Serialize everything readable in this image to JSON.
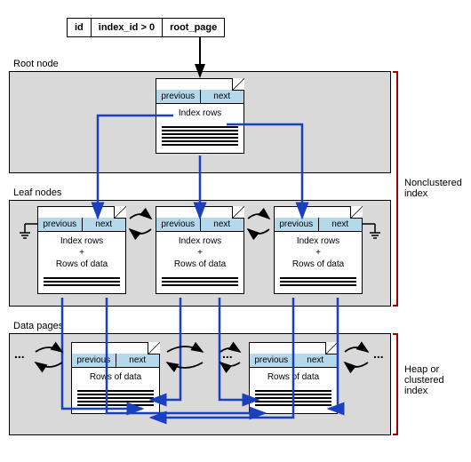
{
  "header": {
    "col1": "id",
    "col2": "index_id > 0",
    "col3": "root_page"
  },
  "bands": {
    "root": "Root node",
    "leaf": "Leaf nodes",
    "data": "Data pages"
  },
  "page": {
    "prev": "previous",
    "next": "next",
    "index_rows": "Index rows",
    "index_rows_plus": "Index rows",
    "plus": "+",
    "rows_of_data": "Rows of data"
  },
  "side": {
    "nonclustered": "Nonclustered index",
    "heap": "Heap or clustered index"
  },
  "dots": "..."
}
